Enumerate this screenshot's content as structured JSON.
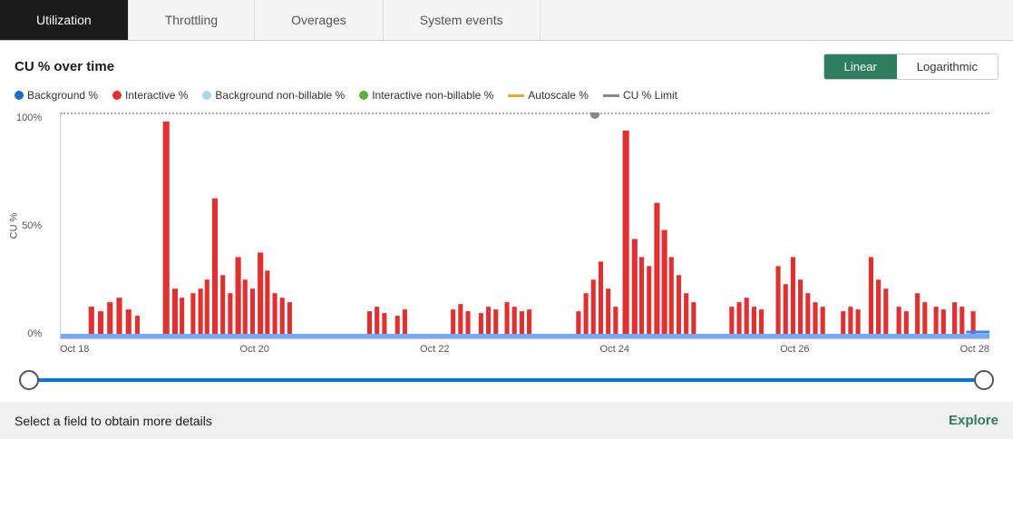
{
  "tabs": [
    {
      "label": "Utilization",
      "active": true
    },
    {
      "label": "Throttling",
      "active": false
    },
    {
      "label": "Overages",
      "active": false
    },
    {
      "label": "System events",
      "active": false
    }
  ],
  "chart": {
    "title": "CU % over time",
    "scale_buttons": [
      {
        "label": "Linear",
        "active": true
      },
      {
        "label": "Logarithmic",
        "active": false
      }
    ],
    "legend": [
      {
        "type": "dot",
        "color": "#1a6fc4",
        "label": "Background %"
      },
      {
        "type": "dot",
        "color": "#e03030",
        "label": "Interactive %"
      },
      {
        "type": "dot",
        "color": "#a8d8f0",
        "label": "Background non-billable %"
      },
      {
        "type": "dot",
        "color": "#5ab03a",
        "label": "Interactive non-billable %"
      },
      {
        "type": "dash",
        "color": "#e8a830",
        "label": "Autoscale %"
      },
      {
        "type": "dash",
        "color": "#888",
        "label": "CU % Limit"
      }
    ],
    "y_labels": [
      "100%",
      "50%",
      "0%"
    ],
    "y_axis_title": "CU %",
    "x_labels": [
      "Oct 18",
      "Oct 20",
      "Oct 22",
      "Oct 24",
      "Oct 26",
      "Oct 28"
    ],
    "dotted_line_position_pct": 58
  },
  "slider": {
    "left_value": 0,
    "right_value": 100
  },
  "bottom": {
    "text": "Select a field to obtain more details",
    "explore_label": "Explore"
  }
}
